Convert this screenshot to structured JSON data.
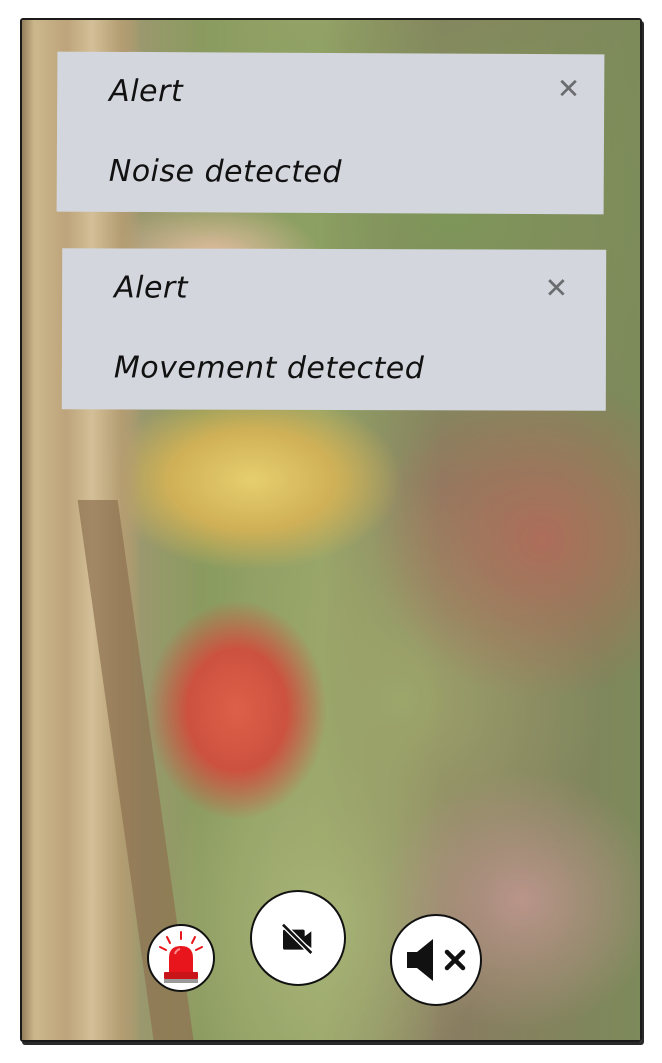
{
  "alerts": [
    {
      "title": "Alert",
      "message": "Noise detected",
      "close_icon": "close-icon"
    },
    {
      "title": "Alert",
      "message": "Movement detected",
      "close_icon": "close-icon"
    }
  ],
  "controls": {
    "siren": {
      "icon": "siren-icon",
      "color": "#e8161c"
    },
    "video": {
      "icon": "video-off-icon"
    },
    "sound": {
      "icon": "volume-mute-icon"
    }
  },
  "colors": {
    "alert_background": "#d3d6dc",
    "alert_text": "#111111",
    "close_icon": "#6a6c70",
    "siren_red": "#e8161c"
  }
}
